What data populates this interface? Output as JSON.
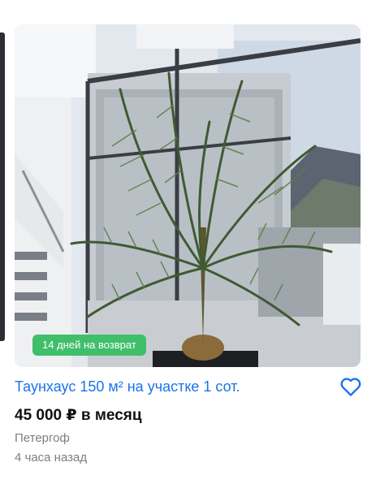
{
  "listing": {
    "badge": "14 дней на возврат",
    "title": "Таунхаус 150 м² на участке 1 сот.",
    "price": "45 000 ₽ в месяц",
    "location": "Петергоф",
    "posted": "4 часа назад",
    "favorite_icon": "heart-outline-icon",
    "photo_subject": "palm-plant-by-window"
  },
  "colors": {
    "title": "#1a73e8",
    "badge": "#3fbf6a",
    "secondary_text": "#7a7f85"
  }
}
